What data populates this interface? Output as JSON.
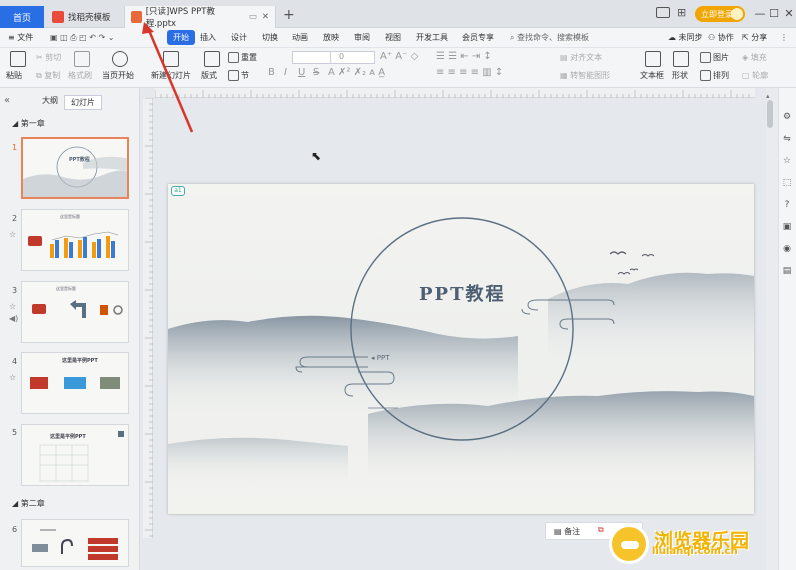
{
  "titlebar": {
    "home_tab": "首页",
    "tabs": [
      {
        "label": "找稻壳模板"
      },
      {
        "label": "[只读]WPS PPT教程.pptx"
      }
    ],
    "new_tab": "+",
    "login_label": "立即登录",
    "window_controls": [
      "—",
      "☐",
      "✕"
    ]
  },
  "menubar": {
    "file_label": "文件",
    "start_label": "开始",
    "items": [
      "插入",
      "设计",
      "切换",
      "动画",
      "放映",
      "审阅",
      "视图",
      "开发工具",
      "会员专享"
    ],
    "search_label": "查找命令、搜索模板",
    "right_items": [
      "未同步",
      "协作",
      "分享"
    ]
  },
  "ribbon": {
    "paste": "粘贴",
    "cut": "剪切",
    "copy": "复制",
    "format_painter": "格式刷",
    "from_current": "当页开始",
    "new_slide": "新建幻灯片",
    "layout": "版式",
    "section": "节",
    "reset": "重置",
    "font_size": "0",
    "align_text": "对齐文本",
    "convert_smartart": "转智能图形",
    "textbox": "文本框",
    "shape": "形状",
    "picture": "图片",
    "fill": "填充",
    "arrange": "排列",
    "outline": "轮廓",
    "bold": "B",
    "italic": "I",
    "underline": "U",
    "strike": "S"
  },
  "leftpanel": {
    "tabs": [
      "大纲",
      "幻灯片"
    ],
    "sections": [
      "第一章",
      "第二章"
    ],
    "slides": [
      {
        "num": "1",
        "title": "PPT教程"
      },
      {
        "num": "2",
        "title": "这里是标题"
      },
      {
        "num": "3",
        "title": "这里是标题"
      },
      {
        "num": "4",
        "title": "这里是平例PPT"
      },
      {
        "num": "5",
        "title": "这里是平例PPT"
      },
      {
        "num": "6",
        "title": ""
      }
    ]
  },
  "slide": {
    "badge": "a1",
    "title": "PPT教程",
    "subtitle": "PPT"
  },
  "bottom_tools": {
    "notes": "备注"
  },
  "watermark": {
    "main": "浏览器乐园",
    "sub": "liulanqi.com.cn"
  }
}
